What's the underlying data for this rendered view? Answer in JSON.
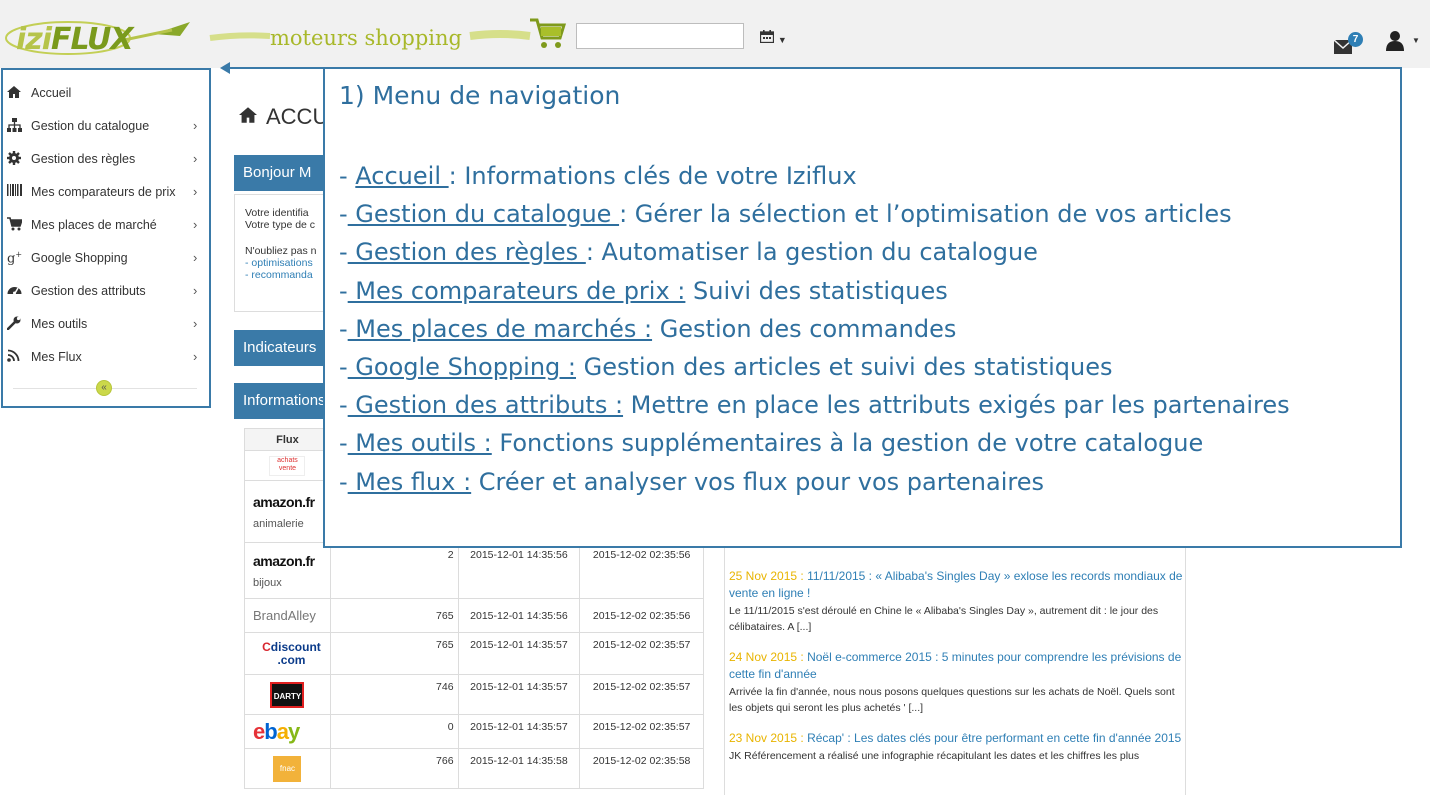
{
  "header": {
    "logo_prefix": "izi",
    "logo_main": "FLUX",
    "tagline": "moteurs shopping",
    "search_value": "",
    "notifications_count": "7"
  },
  "sidebar": {
    "items": [
      {
        "label": "Accueil",
        "icon": "home-icon"
      },
      {
        "label": "Gestion du catalogue",
        "icon": "sitemap-icon"
      },
      {
        "label": "Gestion des règles",
        "icon": "gear-icon"
      },
      {
        "label": "Mes comparateurs de prix",
        "icon": "barcode-icon"
      },
      {
        "label": "Mes places de marché",
        "icon": "cart-icon"
      },
      {
        "label": "Google Shopping",
        "icon": "google-plus-icon"
      },
      {
        "label": "Gestion des attributs",
        "icon": "dashboard-icon"
      },
      {
        "label": "Mes outils",
        "icon": "wrench-icon"
      },
      {
        "label": "Mes Flux",
        "icon": "rss-icon"
      }
    ],
    "collapse_label": "«"
  },
  "main": {
    "title": "ACCUEIL",
    "panel_bonjour": "Bonjour M",
    "info_lines": [
      "Votre identifia",
      "Votre type de c",
      "",
      "N'oubliez pas n",
      "- optimisations",
      "- recommanda"
    ],
    "panel_indicateurs": "Indicateurs",
    "panel_informations": "Informations"
  },
  "table": {
    "header_flux": "Flux",
    "rows": [
      {
        "logo": "achatsvente",
        "label": "achats vente.com",
        "count": "",
        "date1": "",
        "date2": ""
      },
      {
        "logo": "amazon",
        "label": "amazon.fr",
        "sub": "animalerie",
        "count": "",
        "date1": "",
        "date2": ""
      },
      {
        "logo": "amazon",
        "label": "amazon.fr",
        "sub": "bijoux",
        "count": "2",
        "date1": "2015-12-01 14:35:56",
        "date2": "2015-12-02 02:35:56"
      },
      {
        "logo": "brandalley",
        "label": "BrandAlley",
        "count": "765",
        "date1": "2015-12-01 14:35:56",
        "date2": "2015-12-02 02:35:56"
      },
      {
        "logo": "cdiscount",
        "label": "Cdiscount .com",
        "count": "765",
        "date1": "2015-12-01 14:35:57",
        "date2": "2015-12-02 02:35:57"
      },
      {
        "logo": "darty",
        "label": "DARTY",
        "count": "746",
        "date1": "2015-12-01 14:35:57",
        "date2": "2015-12-02 02:35:57"
      },
      {
        "logo": "ebay",
        "label": "ebay",
        "count": "0",
        "date1": "2015-12-01 14:35:57",
        "date2": "2015-12-02 02:35:57"
      },
      {
        "logo": "fnac",
        "label": "fnac",
        "count": "766",
        "date1": "2015-12-01 14:35:58",
        "date2": "2015-12-02 02:35:58"
      }
    ]
  },
  "news": [
    {
      "date": "25 Nov 2015 :",
      "title": "11/11/2015 : « Alibaba's Singles Day » exlose les records mondiaux de vente en ligne !",
      "text": "Le 11/11/2015 s'est déroulé en Chine le « Alibaba's Singles Day », autrement dit : le jour des célibataires. A [...]"
    },
    {
      "date": "24 Nov 2015 :",
      "title": "Noël e-commerce 2015 : 5 minutes pour comprendre les prévisions de cette fin d'année",
      "text": "Arrivée la fin d'année, nous nous posons quelques questions sur les achats de Noël. Quels sont les objets qui seront les plus achetés ' [...]"
    },
    {
      "date": "23 Nov 2015 :",
      "title": "Récap' : Les dates clés pour être performant en cette fin d'année 2015",
      "text": "JK Référencement a réalisé une infographie récapitulant les dates et les chiffres les plus"
    }
  ],
  "overlay": {
    "title": "1) Menu de navigation",
    "lines": [
      {
        "link": "Accueil ",
        "desc": ": Informations clés de votre Iziflux"
      },
      {
        "link": " Gestion du catalogue ",
        "desc": ": Gérer la sélection et l’optimisation de vos articles"
      },
      {
        "link": " Gestion des règles ",
        "desc": ": Automatiser la gestion du catalogue"
      },
      {
        "link": " Mes comparateurs de prix :",
        "desc": " Suivi des statistiques"
      },
      {
        "link": " Mes places de marchés :",
        "desc": " Gestion des commandes"
      },
      {
        "link": " Google Shopping :",
        "desc": " Gestion des articles et suivi des statistiques"
      },
      {
        "link": " Gestion des attributs :",
        "desc": " Mettre en place les attributs exigés par les partenaires"
      },
      {
        "link": " Mes outils :",
        "desc": " Fonctions supplémentaires à la gestion de votre catalogue"
      },
      {
        "link": " Mes flux :",
        "desc": " Créer et analyser vos flux pour vos partenaires"
      }
    ]
  },
  "colors": {
    "accent": "#3a7aa8",
    "brand_green": "#a8b82a",
    "news_date": "#e8b400"
  }
}
